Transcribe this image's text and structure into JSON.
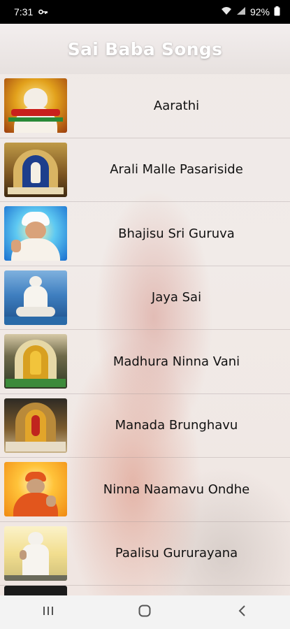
{
  "status": {
    "time": "7:31",
    "battery": "92%"
  },
  "header": {
    "title": "Sai Baba Songs"
  },
  "songs": [
    {
      "label": "Aarathi",
      "thumb": "aarathi-image"
    },
    {
      "label": "Arali Malle Pasariside",
      "thumb": "temple-image"
    },
    {
      "label": "Bhajisu Sri Guruva",
      "thumb": "blessing-image"
    },
    {
      "label": "Jaya Sai",
      "thumb": "seated-ocean-image"
    },
    {
      "label": "Madhura Ninna Vani",
      "thumb": "shrine-image"
    },
    {
      "label": "Manada Brunghavu",
      "thumb": "gold-statue-image"
    },
    {
      "label": "Ninna Naamavu Ondhe",
      "thumb": "orange-glow-image"
    },
    {
      "label": "Paalisu Gururayana",
      "thumb": "standing-image"
    }
  ],
  "nav": {
    "recents": "recents-icon",
    "home": "home-icon",
    "back": "back-icon"
  }
}
